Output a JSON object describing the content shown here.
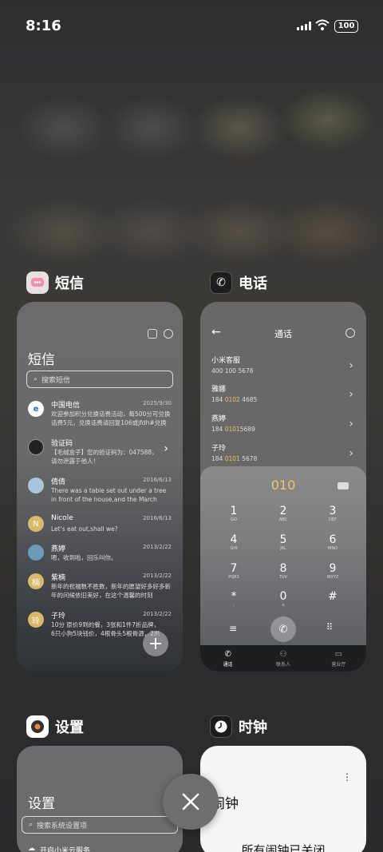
{
  "status": {
    "time": "8:16",
    "battery": "100"
  },
  "recents": {
    "sms": {
      "app_name": "短信",
      "title": "短信",
      "search_placeholder": "搜索短信",
      "messages": [
        {
          "name": "中国电信",
          "date": "2025/9/30",
          "preview": "欢迎参加积分兑换话费活动，每500分可兑换话费5元，兑换话费请回复106或jfdh#兑换"
        },
        {
          "name": "验证码",
          "date": "",
          "preview": "【毛绒盒子】您的验证码为：047588，请勿泄露于他人！"
        },
        {
          "name": "倩倩",
          "date": "2016/6/13",
          "preview": "There was a table set out under a tree in front of the house,and the March Hare an..."
        },
        {
          "name": "Nicole",
          "date": "2016/6/13",
          "preview": "Let's eat out,shall we?",
          "avatar": "N"
        },
        {
          "name": "燕婷",
          "date": "2013/2/22",
          "preview": "嗯，收到啦，回乐叫你。"
        },
        {
          "name": "紫楠",
          "date": "2013/2/22",
          "preview": "新年的祝福数不胜数，新年的愿望好多好多新年的问候依旧美好，在这个温馨的时刻",
          "avatar": "楠"
        },
        {
          "name": "子玲",
          "date": "2013/2/22",
          "preview": "10分 原价9到的餐，3张和1件7折品牌，6只小狗5块钱价，4根骨头5根骨源，2爪都给我。",
          "avatar": "玲"
        }
      ]
    },
    "phone": {
      "app_name": "电话",
      "header": "通话",
      "contacts": [
        {
          "name": "小米客服",
          "pre": "400 100 5678",
          "hl": "",
          "post": ""
        },
        {
          "name": "雅娜",
          "pre": "184 ",
          "hl": "0102",
          "post": " 4685"
        },
        {
          "name": "燕婷",
          "pre": "184 ",
          "hl": "0101",
          "post": "5689"
        },
        {
          "name": "子玲",
          "pre": "184 ",
          "hl": "0101",
          "post": " 5678"
        }
      ],
      "dialed": "010",
      "keys": [
        {
          "d": "1",
          "l": "GO"
        },
        {
          "d": "2",
          "l": "ABC"
        },
        {
          "d": "3",
          "l": "DEF"
        },
        {
          "d": "4",
          "l": "GHI"
        },
        {
          "d": "5",
          "l": "JKL"
        },
        {
          "d": "6",
          "l": "MNO"
        },
        {
          "d": "7",
          "l": "PQRS"
        },
        {
          "d": "8",
          "l": "TUV"
        },
        {
          "d": "9",
          "l": "WXYZ"
        },
        {
          "d": "*",
          "l": ","
        },
        {
          "d": "0",
          "l": "+"
        },
        {
          "d": "#",
          "l": ""
        }
      ],
      "tabs": [
        "通话",
        "联系人",
        "营业厅"
      ]
    },
    "settings": {
      "app_name": "设置",
      "title": "设置",
      "search_placeholder": "搜索系统设置项",
      "first_row": "开启小米云服务"
    },
    "clock": {
      "app_name": "时钟",
      "title": "闹钟",
      "status": "所有闹钟已关闭"
    }
  },
  "colors": {
    "accent": "#f0c46a",
    "card": "#6a6a6c"
  }
}
